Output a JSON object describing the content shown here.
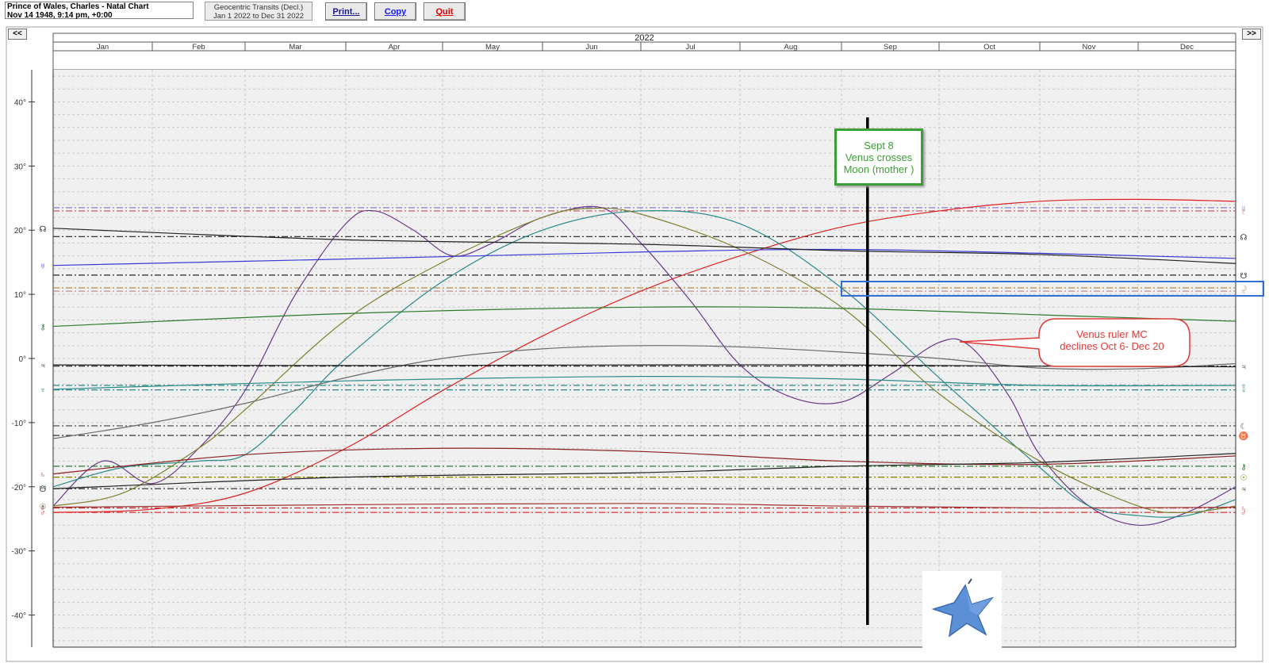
{
  "header": {
    "chart_name": "Prince of Wales, Charles - Natal Chart",
    "chart_details": "Nov 14 1948, 9:14 pm, +0:00",
    "transit_title": "Geocentric Transits (Decl.)",
    "transit_range": "Jan 1 2022 to Dec 31 2022",
    "print_label": "Print...",
    "copy_label": "Copy",
    "quit_label": "Quit",
    "prev_label": "<<",
    "next_label": ">>"
  },
  "colors": {
    "copy": "#1a1aff",
    "quit": "#e00000",
    "annotation_green": "#3aa033",
    "annotation_red": "#e03a3a",
    "highlight_blue": "#2f6fd6"
  },
  "annotations": {
    "green_callout": [
      "Sept 8",
      "Venus crosses",
      "Moon (mother )"
    ],
    "red_callout": [
      "Venus ruler MC",
      "declines Oct 6- Dec 20"
    ]
  },
  "chart_data": {
    "type": "line",
    "title": "2022",
    "months": [
      "Jan",
      "Feb",
      "Mar",
      "Apr",
      "May",
      "Jun",
      "Jul",
      "Aug",
      "Sep",
      "Oct",
      "Nov",
      "Dec"
    ],
    "ylim": [
      -45,
      45
    ],
    "yticks": [
      40,
      30,
      20,
      10,
      0,
      -10,
      -20,
      -30,
      -40
    ],
    "ytick_labels": [
      "40°",
      "30°",
      "20°",
      "10°",
      "0°",
      "-10°",
      "-20°",
      "-30°",
      "-40°"
    ],
    "natal_lines": [
      {
        "glyph": "♅",
        "value": 23.5,
        "color": "#8a7ad8",
        "side": "right"
      },
      {
        "glyph": "♇",
        "value": 23.0,
        "color": "#c05050",
        "side": "right"
      },
      {
        "glyph": "☊",
        "value": 19.0,
        "color": "#222222",
        "side": "right"
      },
      {
        "glyph": "☋",
        "value": 13.0,
        "color": "#222222",
        "side": "right"
      },
      {
        "glyph": "☽",
        "value": 11.0,
        "color": "#b09040",
        "side": "right"
      },
      {
        "glyph": "♄",
        "value": 10.5,
        "color": "#c08080",
        "side": "right"
      },
      {
        "glyph": "♃",
        "value": -1.2,
        "color": "#222222",
        "side": "right"
      },
      {
        "glyph": "♆",
        "value": -4.2,
        "color": "#2a8a8a",
        "side": "right"
      },
      {
        "glyph": "♀",
        "value": -4.9,
        "color": "#2a8a8a",
        "side": "right"
      },
      {
        "glyph": "☾",
        "value": -10.5,
        "color": "#444444",
        "side": "right"
      },
      {
        "glyph": "♉",
        "value": -12.0,
        "color": "#222222",
        "side": "right"
      },
      {
        "glyph": "⚷",
        "value": -16.8,
        "color": "#2a7a2a",
        "side": "right"
      },
      {
        "glyph": "☉",
        "value": -18.5,
        "color": "#808000",
        "side": "right"
      },
      {
        "glyph": "♃",
        "value": -20.3,
        "color": "#222222",
        "side": "right"
      },
      {
        "glyph": "♄",
        "value": -23.3,
        "color": "#c03030",
        "side": "right"
      },
      {
        "glyph": "♂",
        "value": -24.0,
        "color": "#e03030",
        "side": "right"
      }
    ],
    "series": [
      {
        "glyph": "♂",
        "color": "#e02020",
        "points": [
          [
            0,
            -24
          ],
          [
            1,
            -23.5
          ],
          [
            2,
            -21
          ],
          [
            3,
            -14
          ],
          [
            4,
            -5
          ],
          [
            5,
            3.5
          ],
          [
            6,
            10.5
          ],
          [
            7,
            16
          ],
          [
            8,
            20.5
          ],
          [
            9,
            23
          ],
          [
            10,
            24.5
          ],
          [
            11,
            24.8
          ],
          [
            12,
            24.5
          ]
        ]
      },
      {
        "glyph": "♀",
        "color": "#6a3a8a",
        "points": [
          [
            0,
            -23
          ],
          [
            0.5,
            -16
          ],
          [
            1,
            -19.5
          ],
          [
            1.5,
            -14
          ],
          [
            2,
            -5
          ],
          [
            2.5,
            10
          ],
          [
            3,
            21
          ],
          [
            3.3,
            23
          ],
          [
            3.7,
            20
          ],
          [
            4.1,
            16
          ],
          [
            4.5,
            18
          ],
          [
            5,
            22
          ],
          [
            5.6,
            23.5
          ],
          [
            6,
            18
          ],
          [
            6.5,
            9
          ],
          [
            7,
            -1
          ],
          [
            7.5,
            -6
          ],
          [
            8,
            -6.8
          ],
          [
            8.5,
            -2.5
          ],
          [
            9,
            2.5
          ],
          [
            9.3,
            2
          ],
          [
            9.7,
            -6
          ],
          [
            10,
            -15
          ],
          [
            10.5,
            -23
          ],
          [
            11,
            -26
          ],
          [
            11.5,
            -24
          ],
          [
            12,
            -20
          ]
        ]
      },
      {
        "glyph": "☿",
        "color": "#2a8a8a",
        "points": [
          [
            0,
            -20
          ],
          [
            0.7,
            -17
          ],
          [
            1.5,
            -16
          ],
          [
            2,
            -15
          ],
          [
            2.5,
            -8
          ],
          [
            3,
            0
          ],
          [
            4,
            12
          ],
          [
            5,
            20
          ],
          [
            6,
            23
          ],
          [
            7,
            21
          ],
          [
            8,
            11
          ],
          [
            9,
            -3
          ],
          [
            10,
            -17
          ],
          [
            10.5,
            -23
          ],
          [
            11,
            -24.5
          ],
          [
            11.5,
            -24.5
          ],
          [
            12,
            -22
          ]
        ]
      },
      {
        "glyph": "☉",
        "color": "#808030",
        "points": [
          [
            0,
            -23
          ],
          [
            0.7,
            -21
          ],
          [
            1.5,
            -14
          ],
          [
            2,
            -8
          ],
          [
            3,
            6
          ],
          [
            4,
            15
          ],
          [
            5,
            22
          ],
          [
            5.5,
            23.4
          ],
          [
            6,
            22.5
          ],
          [
            7,
            17
          ],
          [
            8,
            8
          ],
          [
            9,
            -5.5
          ],
          [
            10,
            -16
          ],
          [
            11,
            -23
          ],
          [
            11.5,
            -24
          ],
          [
            12,
            -23
          ]
        ]
      },
      {
        "glyph": "☽_node_line",
        "color": "#6a6a6a",
        "points": [
          [
            0,
            -12.5
          ],
          [
            1,
            -10
          ],
          [
            2,
            -7
          ],
          [
            3,
            -3
          ],
          [
            4,
            0
          ],
          [
            5,
            1.5
          ],
          [
            6,
            2
          ],
          [
            7,
            1.8
          ],
          [
            8,
            1
          ],
          [
            9,
            0
          ],
          [
            10,
            -1.5
          ],
          [
            11,
            -1.6
          ],
          [
            12,
            -0.8
          ]
        ]
      },
      {
        "glyph": "♅",
        "color": "#3a3ad8",
        "points": [
          [
            0,
            14.5
          ],
          [
            3,
            15.5
          ],
          [
            6,
            16.6
          ],
          [
            8,
            17
          ],
          [
            10,
            16.4
          ],
          [
            12,
            15.6
          ]
        ]
      },
      {
        "glyph": "☊",
        "color": "#222222",
        "points": [
          [
            0,
            20.3
          ],
          [
            3,
            18.5
          ],
          [
            6,
            17.8
          ],
          [
            8,
            16.8
          ],
          [
            10,
            16.2
          ],
          [
            12,
            14.8
          ]
        ]
      },
      {
        "glyph": "⚷",
        "color": "#2a7a2a",
        "points": [
          [
            0,
            5
          ],
          [
            3,
            7
          ],
          [
            6,
            8
          ],
          [
            8,
            7.8
          ],
          [
            10,
            6.8
          ],
          [
            12,
            5.8
          ]
        ]
      },
      {
        "glyph": "♃",
        "color": "#222222",
        "points": [
          [
            0,
            -1
          ],
          [
            3,
            -1.1
          ],
          [
            6,
            -1
          ],
          [
            8,
            -1
          ],
          [
            10,
            -1.2
          ],
          [
            12,
            -1.3
          ]
        ]
      },
      {
        "glyph": "♆",
        "color": "#2a8a8a",
        "points": [
          [
            0,
            -4.8
          ],
          [
            3,
            -3.5
          ],
          [
            6,
            -2.8
          ],
          [
            8,
            -3.2
          ],
          [
            10,
            -4.2
          ],
          [
            12,
            -4.2
          ]
        ]
      },
      {
        "glyph": "♄",
        "color": "#8a2020",
        "points": [
          [
            0,
            -18
          ],
          [
            2,
            -15
          ],
          [
            4,
            -14
          ],
          [
            6,
            -14.5
          ],
          [
            8,
            -16
          ],
          [
            10,
            -16.5
          ],
          [
            12,
            -15.2
          ]
        ]
      },
      {
        "glyph": "☋",
        "color": "#222222",
        "points": [
          [
            0,
            -20.3
          ],
          [
            3,
            -18.5
          ],
          [
            6,
            -17.8
          ],
          [
            8,
            -16.8
          ],
          [
            10,
            -16.2
          ],
          [
            12,
            -14.8
          ]
        ]
      },
      {
        "glyph": "♇",
        "color": "#a03030",
        "points": [
          [
            0,
            -23.2
          ],
          [
            3,
            -22.8
          ],
          [
            6,
            -22.6
          ],
          [
            8,
            -23
          ],
          [
            10,
            -23.3
          ],
          [
            12,
            -23.2
          ]
        ]
      }
    ]
  }
}
